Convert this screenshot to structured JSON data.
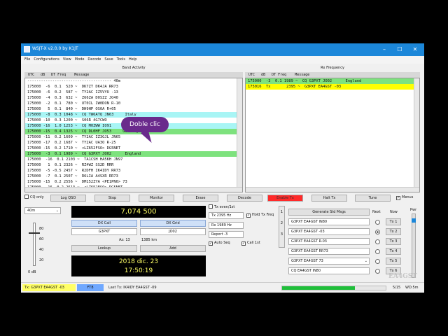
{
  "titlebar": {
    "title": "WSJT-X   v2.0.0   by K1JT",
    "minimize": "–",
    "maximize": "☐",
    "close": "✕"
  },
  "menu": [
    "File",
    "Configurations",
    "View",
    "Mode",
    "Decode",
    "Save",
    "Tools",
    "Help"
  ],
  "band_activity": {
    "header": "Band Activity",
    "columns": "UTC   dB   DT Freq    Message",
    "lines": [
      {
        "text": "------------------------------------- 40m",
        "bg": ""
      },
      {
        "text": "175000  -6  0.1  520 ~  DK7ZT DK4JA RR73",
        "bg": ""
      },
      {
        "text": "175000  -6  0.2  587 ~  TY2AC IZ5VYU -13",
        "bg": ""
      },
      {
        "text": "175000  -4  0.3  632 ~  Z66ZA D0SZZ JO40",
        "bg": ""
      },
      {
        "text": "175000  -2  0.1  780 ~  UT0IL IW0DON R-10",
        "bg": ""
      },
      {
        "text": "175000   5  0.1  840 ~  DH9HP OS0A R+05",
        "bg": ""
      },
      {
        "text": "175000  -8  0.3 1048 ~  CQ TW6ATQ JN63     Italy",
        "bg": "#a8f5f5"
      },
      {
        "text": "175000 -10  0.3 1200 ~  S06R 4G7CWO",
        "bg": ""
      },
      {
        "text": "175000 -16  1.0 1253 ~  CQ M0ZWW IO91",
        "bg": "#a8f5f5"
      },
      {
        "text": "175000 -15  0.4 1325 ~  CQ DL0HF JO53     Germany",
        "bg": "#7ee27e"
      },
      {
        "text": "175000 -11  0.2 1609 ~  TY2AC IZ3GJL JN65",
        "bg": ""
      },
      {
        "text": "175000 -17  0.2 1687 ~  TY2AC UA3O R-25",
        "bg": ""
      },
      {
        "text": "175000 -15  0.2 1710 ~  <LZ652FSO> DG5NET",
        "bg": ""
      },
      {
        "text": "175000  -3  0.1 1989 ~  CQ G3PXT JO02      England",
        "bg": "#7ee27e"
      },
      {
        "text": "175000  -16  0.1 2103 ~  TA1CSH HA5KH JN97",
        "bg": ""
      },
      {
        "text": "175000   1  0.1 2326 ~  RZ4WZ SS2D RRR",
        "bg": ""
      },
      {
        "text": "175000  -5 -0.5 2457 ~  R2DFH IK4IDY RR73",
        "bg": ""
      },
      {
        "text": "175000  -7  0.1 2507 ~  R6LIA A4SXR RR73",
        "bg": ""
      },
      {
        "text": "175000 -15  0.2 2556 ~  DM152ZYA <PE1PN0> 73",
        "bg": ""
      },
      {
        "text": "175000  -16  0.2 2613 ~  <LZ652FSO> DG5NET",
        "bg": ""
      }
    ]
  },
  "rx_frequency": {
    "header": "Rx Frequency",
    "columns": "UTC   dB   DT Freq    Message",
    "lines": [
      {
        "text": "175000  -3  0.1 1989 ~  CQ G3PXT JO02      England",
        "bg": "#7ee27e"
      },
      {
        "text": "175016  Tx       2395 ~  G3PXT EA4GST -03",
        "bg": "#ffff00"
      }
    ]
  },
  "callout": "Doble clic",
  "buttons": {
    "cq_only": "CQ only",
    "log_qso": "Log QSO",
    "stop": "Stop",
    "monitor": "Monitor",
    "erase": "Erase",
    "decode": "Decode",
    "enable_tx": "Enable Tx",
    "halt_tx": "Halt Tx",
    "tune": "Tune",
    "menus": "Menus"
  },
  "band": "40m",
  "frequency": "7,074 500",
  "dx_call_label": "DX Call",
  "dx_grid_label": "DX Grid",
  "dx_call": "G3PXT",
  "dx_grid": "JO02",
  "az": "Az: 13",
  "distance": "1385 km",
  "lookup": "Lookup",
  "add": "Add",
  "date": "2018 dic. 23",
  "time": "17:50:19",
  "meter": {
    "ticks": [
      "80",
      "60",
      "40",
      "20"
    ],
    "readout": "0 dB"
  },
  "tx_controls": {
    "tx_even": "Tx even/1st",
    "tx_freq": "Tx  2395 Hz",
    "hold_tx": "Hold Tx Freq",
    "rx_freq": "Rx  1989 Hz",
    "report": "Report -3",
    "auto_seq": "Auto Seq",
    "call_1st": "Call 1st"
  },
  "messages": {
    "generate": "Generate Std Msgs",
    "next": "Next",
    "now": "Now",
    "pwr": "Pwr",
    "items": [
      {
        "msg": "G3PXT EA4GST IN80",
        "tx": "Tx 1"
      },
      {
        "msg": "G3PXT EA4GST -03",
        "tx": "Tx 2"
      },
      {
        "msg": "G3PXT EA4GST R-03",
        "tx": "Tx 3"
      },
      {
        "msg": "G3PXT EA4GST RR73",
        "tx": "Tx 4"
      },
      {
        "msg": "G3PXT EA4GST 73",
        "tx": "Tx 5"
      },
      {
        "msg": "CQ EA4GST IN80",
        "tx": "Tx 6"
      }
    ]
  },
  "tabs": [
    "1",
    "2",
    "3"
  ],
  "status": {
    "tx": "Tx: G3PXT EA4GST -03",
    "mode": "FT8",
    "last_tx": "Last Tx: IK4IDY EA4GST -09",
    "progress": 0.7,
    "count": "5/15",
    "wd": "WD:5m"
  },
  "watermark": "EA4GST",
  "colors": {
    "title": "#1c87d9",
    "enable_tx": "#ff2a2a",
    "status_tx": "#ffff66",
    "status_mode": "#6fa8ff",
    "progress": "#1fbf3a",
    "display_bg": "#000000",
    "display_fg": "#ffff66"
  }
}
